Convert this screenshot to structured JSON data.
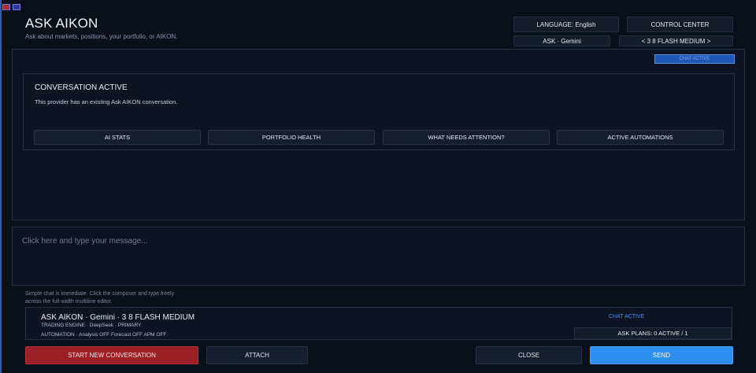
{
  "header": {
    "title": "ASK AIKON",
    "subtitle": "Ask about markets, positions, your portfolio, or AIKON.",
    "language_button": "LANGUAGE: English",
    "control_center_button": "CONTROL CENTER",
    "provider_label": "ASK · Gemini",
    "model_selector": "< 3 8 FLASH MEDIUM >"
  },
  "main": {
    "chat_badge": "CHAT ACTIVE",
    "conversation": {
      "title": "CONVERSATION ACTIVE",
      "description": "This provider has an existing Ask AIKON conversation."
    },
    "quick_actions": [
      "AI STATS",
      "PORTFOLIO HEALTH",
      "WHAT NEEDS ATTENTION?",
      "ACTIVE AUTOMATIONS"
    ]
  },
  "composer": {
    "placeholder": "Click here and type your message...",
    "hint": "Simple chat is immediate. Click the composer and type freely across the full-width multiline editor."
  },
  "status": {
    "title": "ASK AIKON  ·  Gemini  ·  3 8 FLASH MEDIUM",
    "line1": "TRADING ENGINE  ·  DeepSeek  ·  PRIMARY",
    "line2": "AUTOMATION  ·  Analysis OFF   Forecast OFF   APM OFF",
    "chat_status": "CHAT ACTIVE",
    "plans": "ASK PLANS: 0 ACTIVE / 1"
  },
  "actions": {
    "start_new": "START NEW CONVERSATION",
    "attach": "ATTACH",
    "close": "CLOSE",
    "send": "SEND"
  },
  "colors": {
    "background": "#0a0f1c",
    "accent_blue": "#2f8ff0",
    "danger_red": "#9b1f27",
    "status_blue": "#4f8ee8"
  },
  "icons": [
    "window-menu-icon",
    "window-restore-icon"
  ]
}
